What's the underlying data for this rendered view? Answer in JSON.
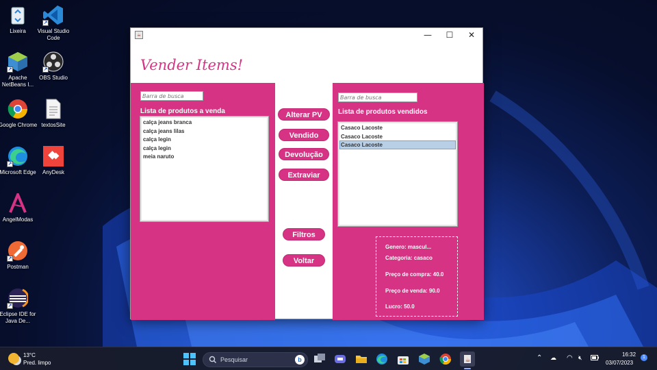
{
  "desktop": {
    "icons": [
      {
        "label": "Lixeira",
        "icon": "recycle-bin-icon"
      },
      {
        "label": "Visual Studio Code",
        "icon": "vscode-icon"
      },
      {
        "label": "Apache NetBeans I...",
        "icon": "netbeans-icon"
      },
      {
        "label": "OBS Studio",
        "icon": "obs-icon"
      },
      {
        "label": "Google Chrome",
        "icon": "chrome-icon"
      },
      {
        "label": "textosSite",
        "icon": "text-file-icon"
      },
      {
        "label": "Microsoft Edge",
        "icon": "edge-icon"
      },
      {
        "label": "AnyDesk",
        "icon": "anydesk-icon"
      },
      {
        "label": "AngelModas",
        "icon": "angelmodas-icon"
      },
      {
        "label": "Postman",
        "icon": "postman-icon"
      },
      {
        "label": "Eclipse IDE for Java De...",
        "icon": "eclipse-icon"
      }
    ]
  },
  "window": {
    "controls": {
      "minimize": "—",
      "maximize": "☐",
      "close": "✕"
    },
    "title": "Vender Items!",
    "left_panel": {
      "search_placeholder": "Barra de busca",
      "list_label": "Lista de produtos a venda",
      "items": [
        "calça jeans branca",
        "calça jeans lilas",
        "calça legin",
        "calça legin",
        "meia naruto"
      ]
    },
    "buttons": {
      "alterar": "Alterar PV",
      "vendido": "Vendido",
      "devolucao": "Devolução",
      "extraviar": "Extraviar",
      "filtros": "Filtros",
      "voltar": "Voltar"
    },
    "right_panel": {
      "search_placeholder": "Barra de busca",
      "list_label": "Lista de produtos vendidos",
      "items": [
        "Casaco Lacoste",
        "Casaco Lacoste",
        "Casaco Lacoste"
      ],
      "selected_index": 2
    },
    "details": {
      "genero": "Genero:  mascul...",
      "categoria": "Categoria:  casaco",
      "preco_compra": "Preço de compra:  40.0",
      "preco_venda": "Preço de venda:  90.0",
      "lucro": "Lucro:   50.0"
    }
  },
  "taskbar": {
    "weather_temp": "13°C",
    "weather_desc": "Pred. limpo",
    "search_placeholder": "Pesquisar",
    "time": "16:32",
    "date": "03/07/2023",
    "notification_count": "1"
  },
  "colors": {
    "accent_pink": "#d63384",
    "taskbar": "#181c2c"
  }
}
